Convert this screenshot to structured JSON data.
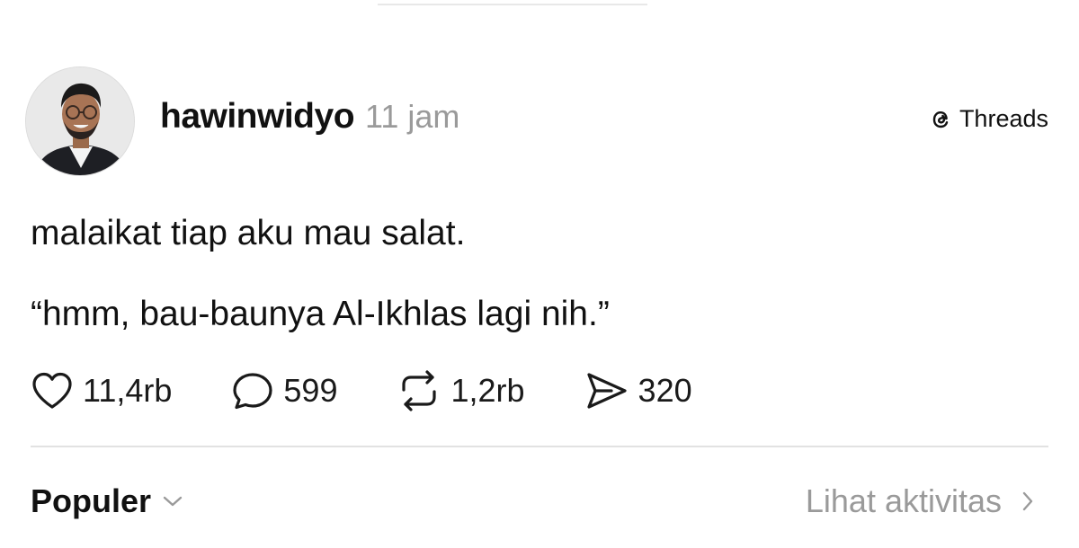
{
  "post": {
    "author": {
      "username": "hawinwidyo",
      "avatar_icon": "profile-photo"
    },
    "timestamp": "11 jam",
    "source": {
      "icon": "threads-logo-icon",
      "label": "Threads"
    },
    "text_lines": [
      "malaikat tiap aku mau salat.",
      "“hmm, bau-baunya Al-Ikhlas lagi nih.”"
    ],
    "actions": {
      "like": {
        "icon": "heart-icon",
        "count": "11,4rb"
      },
      "reply": {
        "icon": "comment-bubble-icon",
        "count": "599"
      },
      "repost": {
        "icon": "repost-icon",
        "count": "1,2rb"
      },
      "share": {
        "icon": "send-icon",
        "count": "320"
      }
    }
  },
  "footer": {
    "sort_label": "Populer",
    "activity_label": "Lihat aktivitas"
  },
  "colors": {
    "text": "#111111",
    "muted": "#9a9a9a",
    "divider": "#e2e2e2",
    "background": "#ffffff"
  }
}
